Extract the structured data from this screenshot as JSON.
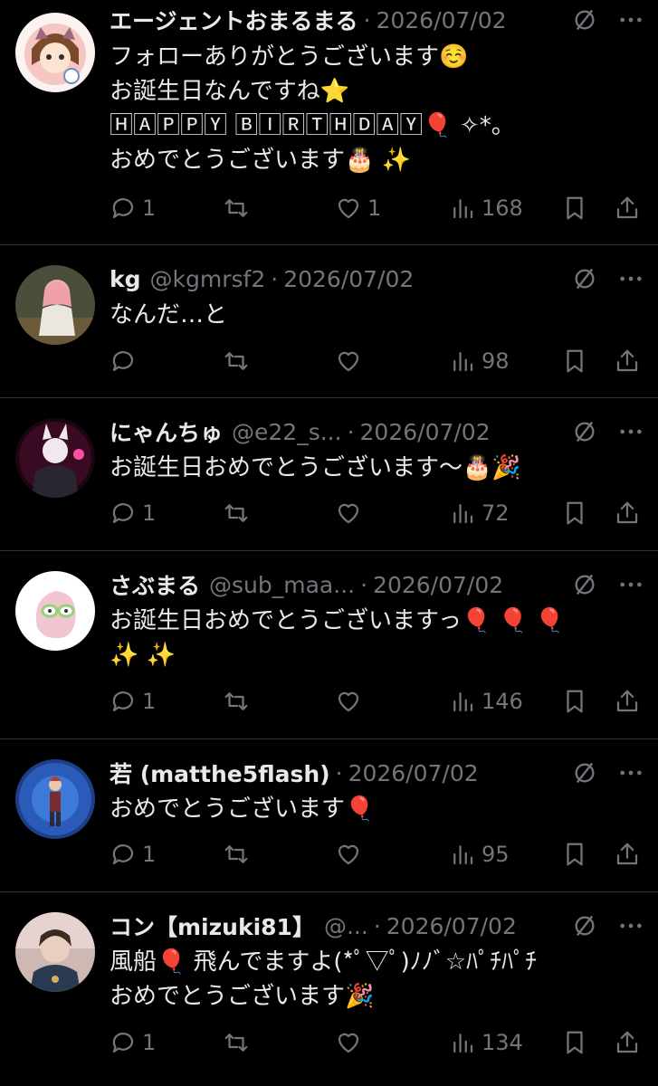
{
  "colors": {
    "background": "#000000",
    "text": "#e7e9ea",
    "muted": "#71767b",
    "divider": "#2f3336"
  },
  "tweets": [
    {
      "name": "エージェントおまるまる",
      "handle": "",
      "date": "2026/07/02",
      "text": "フォローありがとうございます☺️\nお誕生日なんですね⭐\n🄷🄰🄿🄿🅈 🄱🄸🅁🅃🄷🄳🄰🅈🎈 ✧*。\nおめでとうございます🎂 ✨",
      "replies": "1",
      "retweets": "",
      "likes": "1",
      "views": "168"
    },
    {
      "name": "kg",
      "handle": "@kgmrsf2",
      "date": "2026/07/02",
      "text": "なんだ…と",
      "replies": "",
      "retweets": "",
      "likes": "",
      "views": "98"
    },
    {
      "name": "にゃんちゅ",
      "handle": "@e22_s...",
      "date": "2026/07/02",
      "text": "お誕生日おめでとうございます〜🎂🎉",
      "replies": "1",
      "retweets": "",
      "likes": "",
      "views": "72"
    },
    {
      "name": "さぶまる",
      "handle": "@sub_maa...",
      "date": "2026/07/02",
      "text": "お誕生日おめでとうございますっ🎈 🎈 🎈\n✨ ✨",
      "replies": "1",
      "retweets": "",
      "likes": "",
      "views": "146"
    },
    {
      "name": "若 (matthe5flash)",
      "handle": "",
      "date": "2026/07/02",
      "text": "おめでとうございます🎈",
      "replies": "1",
      "retweets": "",
      "likes": "",
      "views": "95"
    },
    {
      "name": "コン【mizuki81】",
      "handle": "@...",
      "date": "2026/07/02",
      "text": "風船🎈 飛んでますよ(*ﾟ▽ﾟ)ﾉﾉﾞ☆ﾊﾟﾁﾊﾟﾁ\nおめでとうございます🎉",
      "replies": "1",
      "retweets": "",
      "likes": "",
      "views": "134"
    }
  ],
  "icons": {
    "reply": "reply-icon",
    "retweet": "retweet-icon",
    "like": "heart-icon",
    "views": "views-icon",
    "bookmark": "bookmark-icon",
    "share": "share-icon",
    "grok": "grok-icon",
    "more": "more-icon"
  }
}
